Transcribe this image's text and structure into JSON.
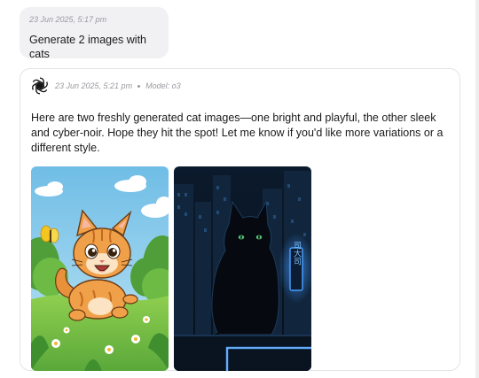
{
  "user_message": {
    "timestamp": "23 Jun 2025, 5:17 pm",
    "text": "Generate 2 images with cats"
  },
  "assistant_message": {
    "timestamp": "23 Jun 2025, 5:21 pm",
    "model_label": "Model: o3",
    "text": "Here are two freshly generated cat images—one bright and playful, the other sleek and cyber-noir. Hope they hit the spot! Let me know if you'd like more variations or a different style.",
    "avatar_icon": "openai-logo-icon",
    "images": [
      {
        "name": "cartoon-cat-image",
        "neon_sign_text": ""
      },
      {
        "name": "cyber-noir-cat-image",
        "neon_sign_text": "司大司"
      }
    ]
  },
  "colors": {
    "user_bubble_bg": "#f1f1f3",
    "card_border": "#e4e4e7",
    "meta_text": "#9a9aa0",
    "neon_accent": "#3a7bd5"
  }
}
